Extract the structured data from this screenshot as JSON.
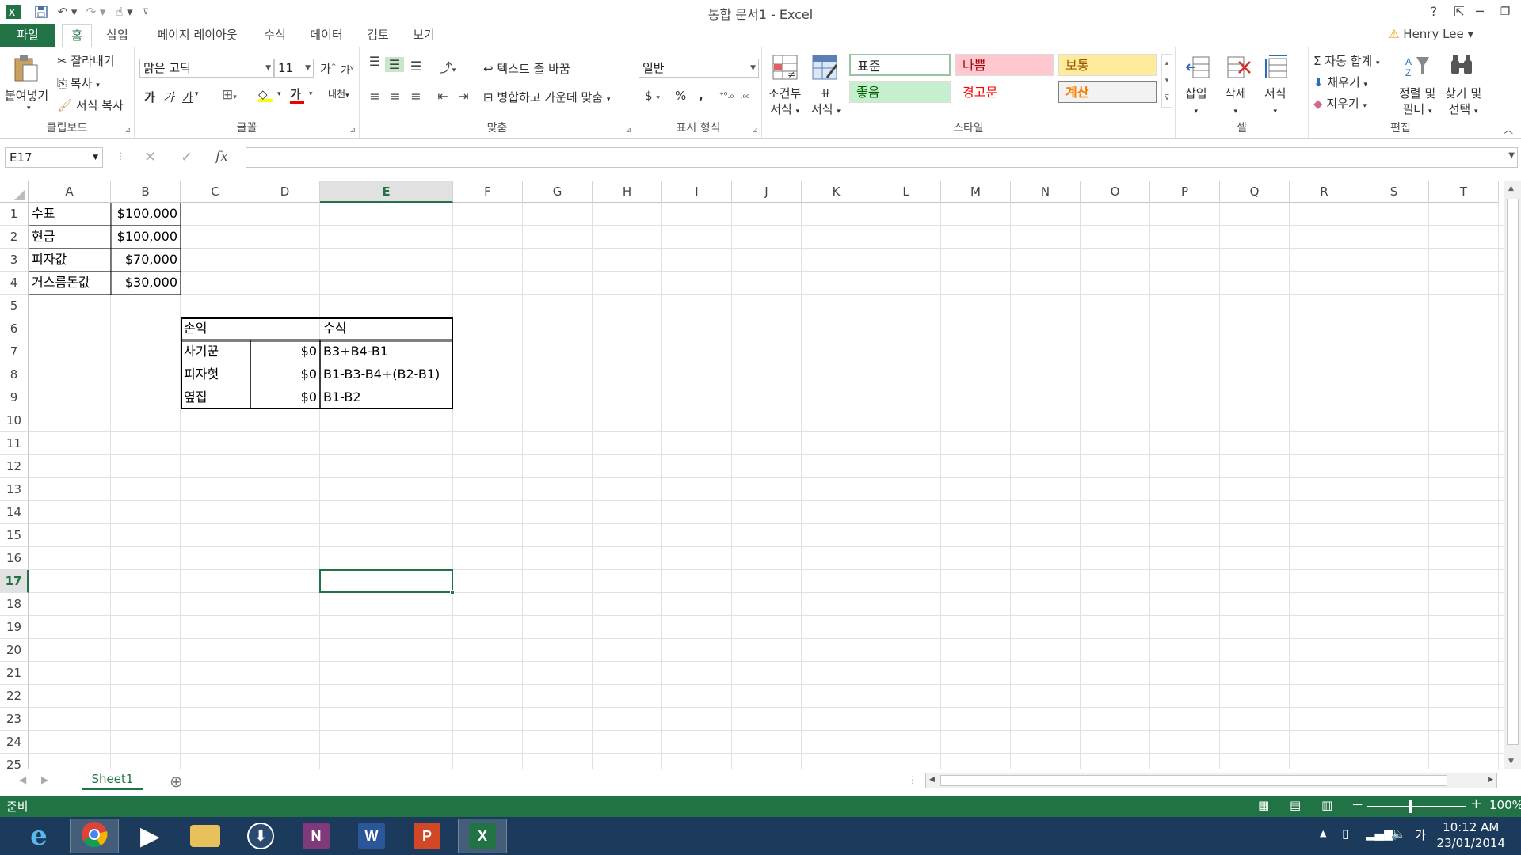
{
  "window": {
    "title": "통합 문서1 - Excel",
    "help": "?",
    "minimize": "─",
    "restore": "❐",
    "close": "✕"
  },
  "tabs": {
    "file": "파일",
    "items": [
      "홈",
      "삽입",
      "페이지 레이아웃",
      "수식",
      "데이터",
      "검토",
      "보기"
    ]
  },
  "user": {
    "name": "Henry Lee"
  },
  "ribbon": {
    "clipboard": {
      "label": "클립보드",
      "paste": "붙여넣기",
      "cut": "잘라내기",
      "copy": "복사",
      "format_painter": "서식 복사"
    },
    "font": {
      "label": "글꼴",
      "name": "맑은 고딕",
      "size": "11",
      "grow": "가",
      "shrink": "가",
      "bold": "가",
      "italic": "가",
      "underline": "가"
    },
    "alignment": {
      "label": "맞춤",
      "wrap": "텍스트 줄 바꿈",
      "merge": "병합하고 가운데 맞춤"
    },
    "number": {
      "label": "표시 형식",
      "format": "일반",
      "currency": "$",
      "percent": "%",
      "comma": ","
    },
    "styles": {
      "label": "스타일",
      "conditional": [
        "조건부",
        "서식"
      ],
      "table": [
        "표",
        "서식"
      ],
      "normal": "표준",
      "bad": "나쁨",
      "neutral": "보통",
      "good": "좋음",
      "warning": "경고문",
      "calc": "계산"
    },
    "cells": {
      "label": "셀",
      "insert": "삽입",
      "delete": "삭제",
      "format": "서식"
    },
    "editing": {
      "label": "편집",
      "autosum": "자동 합계",
      "fill": "채우기",
      "clear": "지우기",
      "sort": [
        "정렬 및",
        "필터"
      ],
      "find": [
        "찾기 및",
        "선택"
      ]
    }
  },
  "formula_bar": {
    "name_box": "E17",
    "fx": "fx",
    "value": ""
  },
  "columns": [
    "A",
    "B",
    "C",
    "D",
    "E",
    "F",
    "G",
    "H",
    "I",
    "J",
    "K",
    "L",
    "M",
    "N",
    "O",
    "P",
    "Q",
    "R",
    "S",
    "T"
  ],
  "rows": [
    "1",
    "2",
    "3",
    "4",
    "5",
    "6",
    "7",
    "8",
    "9",
    "10",
    "11",
    "12",
    "13",
    "14",
    "15",
    "16",
    "17",
    "18",
    "19",
    "20",
    "21",
    "22",
    "23",
    "24",
    "25"
  ],
  "cells": {
    "A1": "수표",
    "B1": "$100,000",
    "A2": "현금",
    "B2": "$100,000",
    "A3": "피자값",
    "B3": "$70,000",
    "A4": "거스름돈값",
    "B4": "$30,000",
    "C6": "손익",
    "E6": "수식",
    "C7": "사기꾼",
    "D7": "$0",
    "E7": "B3+B4-B1",
    "C8": "피자헛",
    "D8": "$0",
    "E8": "B1-B3-B4+(B2-B1)",
    "C9": "옆집",
    "D9": "$0",
    "E9": "B1-B2"
  },
  "selected": {
    "cell": "E17",
    "column": "E",
    "row": "17"
  },
  "sheets": {
    "tab": "Sheet1",
    "add": "⊕"
  },
  "status": {
    "ready": "준비",
    "zoom": "100%"
  },
  "taskbar": {
    "time": "10:12 AM",
    "date": "23/01/2014",
    "ime": "가"
  },
  "colors": {
    "accent": "#217346",
    "bad_bg": "#ffc7ce",
    "bad_fg": "#9c0006",
    "good_bg": "#c6efce",
    "good_fg": "#006100",
    "neutral_bg": "#ffeb9c",
    "neutral_fg": "#9c5700",
    "calc_fg": "#fa7d00"
  }
}
